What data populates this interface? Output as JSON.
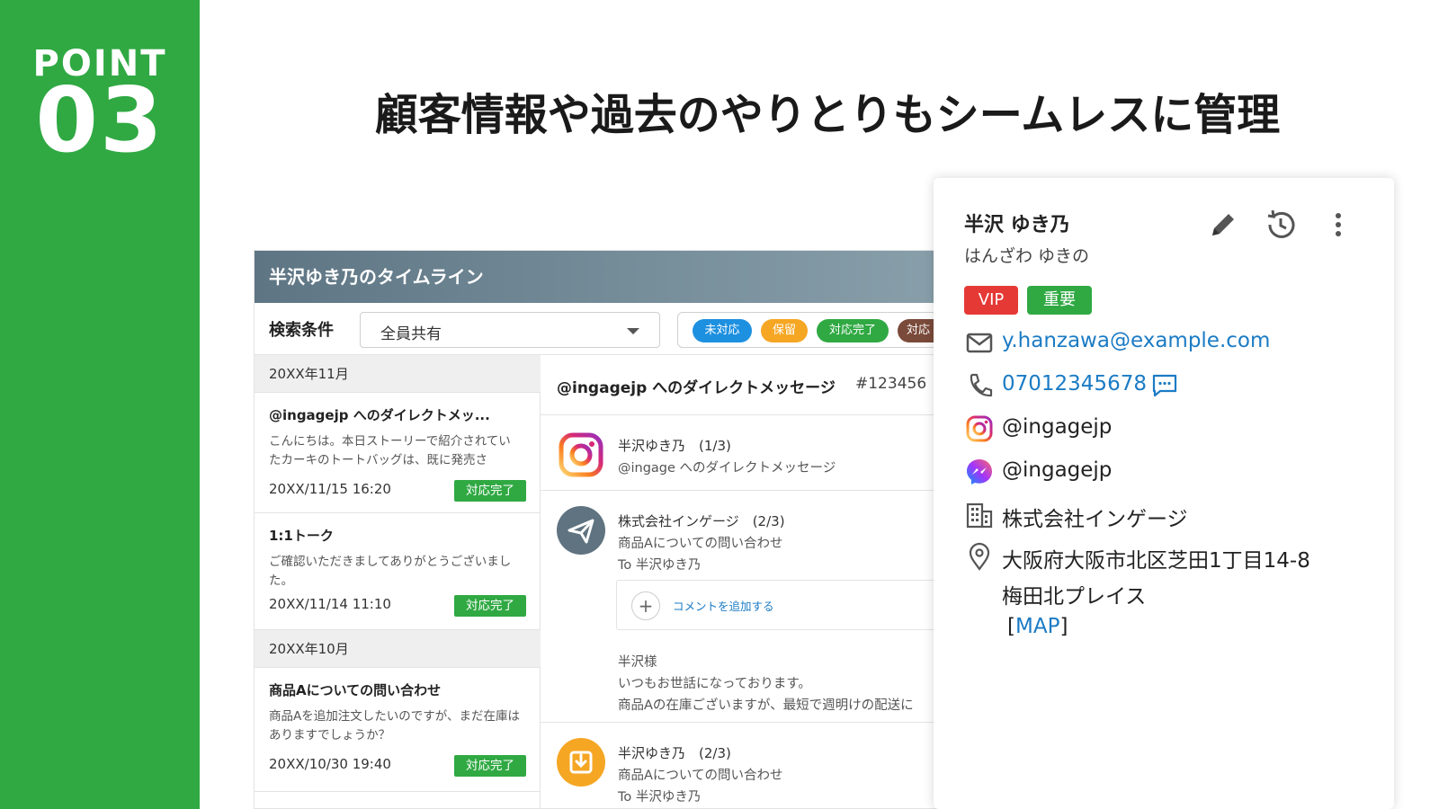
{
  "point": {
    "label": "POINT",
    "number": "03"
  },
  "headline": "顧客情報や過去のやりとりもシームレスに管理",
  "timeline": {
    "title": "半沢ゆき乃のタイムライン",
    "search_label": "検索条件",
    "select_value": "全員共有",
    "filters": [
      {
        "label": "未対応",
        "color": "#1e90e0"
      },
      {
        "label": "保留",
        "color": "#f5a623"
      },
      {
        "label": "対応完了",
        "color": "#30a943"
      },
      {
        "label": "対応",
        "color": "#7a4a3a"
      }
    ],
    "months": [
      "20XX年11月",
      "20XX年10月"
    ],
    "cards": [
      {
        "title": "@ingagejp へのダイレクトメッ...",
        "body": "こんにちは。本日ストーリーで紹介されていたカーキのトートバッグは、既に発売さ",
        "time": "20XX/11/15 16:20",
        "status": "対応完了"
      },
      {
        "title": "1:1トーク",
        "body": "ご確認いただきましてありがとうございました。",
        "time": "20XX/11/14 11:10",
        "status": "対応完了"
      },
      {
        "title": "商品Aについての問い合わせ",
        "body": "商品Aを追加注文したいのですが、まだ在庫はありますでしょうか？",
        "time": "20XX/10/30 19:40",
        "status": "対応完了"
      }
    ],
    "detail": {
      "title": "@ingagejp へのダイレクトメッセージ",
      "id": "#123456",
      "messages": [
        {
          "name": "半沢ゆき乃　(1/3)",
          "lines": [
            "@ingage へのダイレクトメッセージ"
          ],
          "avatar_icon": "instagram-icon"
        },
        {
          "name": "株式会社インゲージ　(2/3)",
          "lines": [
            "商品Aについての問い合わせ",
            "To 半沢ゆき乃"
          ],
          "avatar_icon": "send-icon"
        },
        {
          "name": "半沢ゆき乃　(2/3)",
          "lines": [
            "商品Aについての問い合わせ",
            "To 半沢ゆき乃"
          ],
          "avatar_icon": "inbox-icon"
        }
      ],
      "comment_add": "コメントを追加する",
      "reply_lines": [
        "半沢様",
        "いつもお世話になっております。",
        "商品Aの在庫ございますが、最短で週明けの配送に"
      ]
    }
  },
  "profile": {
    "name": "半沢 ゆき乃",
    "kana": "はんざわ ゆきの",
    "tags": [
      {
        "label": "VIP",
        "color": "#e53935"
      },
      {
        "label": "重要",
        "color": "#30a943"
      }
    ],
    "email": "y.hanzawa@example.com",
    "phone": "07012345678",
    "instagram": "@ingagejp",
    "messenger": "@ingagejp",
    "company": "株式会社インゲージ",
    "address_line1": "大阪府大阪市北区芝田1丁目14-8",
    "address_line2": "梅田北プレイス",
    "map_bracket_open": "[",
    "map_link": "MAP",
    "map_bracket_close": "]"
  }
}
